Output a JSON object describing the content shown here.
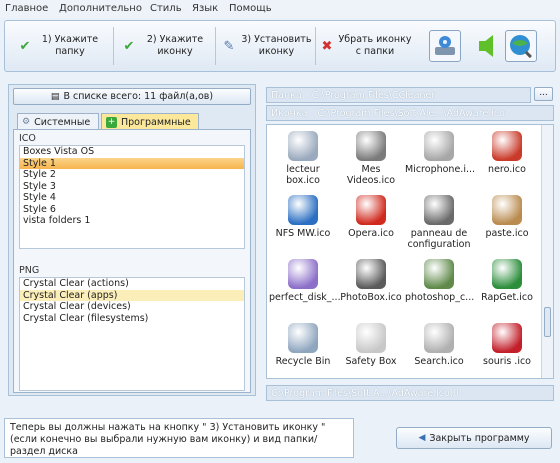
{
  "menu": [
    "Главное",
    "Дополнительно",
    "Стиль",
    "Язык",
    "Помощь"
  ],
  "toolbar": {
    "step1": "1) Укажите папку",
    "step2": "2) Укажите иконку",
    "step3": "3) Установить иконку",
    "remove": "Убрать иконку с папки"
  },
  "left": {
    "count_label": "В списке всего: 11 файл(а,ов)",
    "tab_system": "Системные",
    "tab_programs": "Программные",
    "ico_label": "ICO",
    "ico_items": [
      "Boxes Vista OS",
      "Style 1",
      "Style 2",
      "Style 3",
      "Style 4",
      "Style 6",
      "vista folders 1"
    ],
    "png_label": "PNG",
    "png_items": [
      "Crystal Clear (actions)",
      "Crystal Clear (apps)",
      "Crystal Clear (devices)",
      "Crystal Clear (filesystems)"
    ]
  },
  "paths": {
    "folder_key": "Папка",
    "folder_val": "C:\\Program Files\\CCleaner",
    "icon_key": "Иконка",
    "icon_val": "C:\\Program Files\\Soft Ale...\\AdAware.ico",
    "bottom_val": "C:\\Program Files\\Soft A...\\AdAware.ico,0",
    "browse": "..."
  },
  "icons": [
    {
      "label": "lecteur box.ico",
      "icon": "media-player-icon",
      "color": "#9aa9bd"
    },
    {
      "label": "Mes Videos.ico",
      "icon": "video-camera-icon",
      "color": "#7b7b7b"
    },
    {
      "label": "Microphone.i...",
      "icon": "microphone-icon",
      "color": "#a7a7a7"
    },
    {
      "label": "nero.ico",
      "icon": "nero-icon",
      "color": "#c93a2a"
    },
    {
      "label": "NFS MW.ico",
      "icon": "nfs-icon",
      "color": "#2a6fc2"
    },
    {
      "label": "Opera.ico",
      "icon": "opera-icon",
      "color": "#d02a1f"
    },
    {
      "label": "panneau de configuration",
      "icon": "control-panel-icon",
      "color": "#6a6a6a"
    },
    {
      "label": "paste.ico",
      "icon": "clipboard-icon",
      "color": "#b98b4f"
    },
    {
      "label": "perfect_disk_...",
      "icon": "perfect-disk-icon",
      "color": "#8c6fc9"
    },
    {
      "label": "PhotoBox.ico",
      "icon": "photobox-icon",
      "color": "#5b5b5b"
    },
    {
      "label": "photoshop_c...",
      "icon": "photoshop-icon",
      "color": "#5f8a4a"
    },
    {
      "label": "RapGet.ico",
      "icon": "rapget-icon",
      "color": "#2c8d3b"
    },
    {
      "label": "Recycle Bin",
      "icon": "recycle-bin-icon",
      "color": "#8fa6bf"
    },
    {
      "label": "Safety Box",
      "icon": "safety-box-icon",
      "color": "#c8c8c8"
    },
    {
      "label": "Search.ico",
      "icon": "search-icon",
      "color": "#b0b0b0"
    },
    {
      "label": "souris .ico",
      "icon": "mouse-icon",
      "color": "#c21f2a"
    }
  ],
  "status_text": "Теперь вы должны нажать на кнопку \" 3)  Установить иконку \" (если конечно вы выбрали нужную вам иконку) и вид папки/раздел диска",
  "close_label": "Закрыть программу",
  "colors": {
    "accent": "#fbd48a",
    "highlight": "#fbeeb8"
  }
}
